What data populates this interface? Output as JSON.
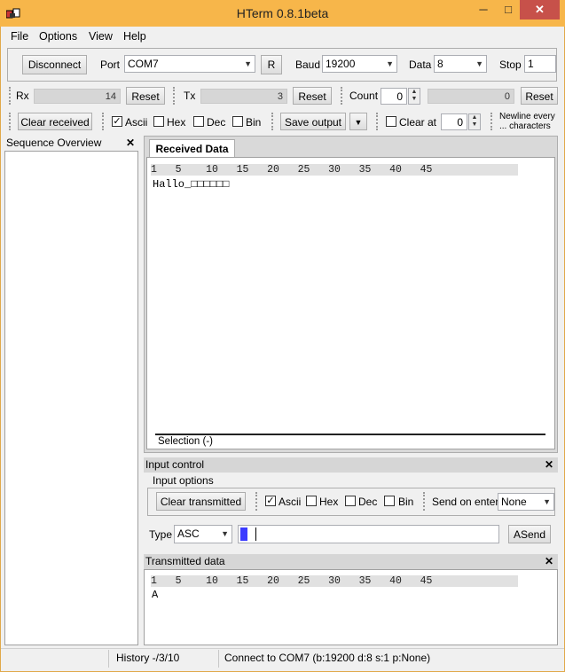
{
  "window": {
    "title": "HTerm 0.8.1beta",
    "min": "─",
    "max": "□",
    "close": "✕"
  },
  "menu": [
    "File",
    "Options",
    "View",
    "Help"
  ],
  "connection": {
    "disconnect": "Disconnect",
    "port_label": "Port",
    "port_value": "COM7",
    "r_button": "R",
    "baud_label": "Baud",
    "baud_value": "19200",
    "data_label": "Data",
    "data_value": "8",
    "stop_label": "Stop",
    "stop_value": "1"
  },
  "counters": {
    "rx_label": "Rx",
    "rx_value": "14",
    "rx_reset": "Reset",
    "tx_label": "Tx",
    "tx_value": "3",
    "tx_reset": "Reset",
    "count_label": "Count",
    "count_value": "0",
    "count_display": "0",
    "count_reset": "Reset"
  },
  "display_opts": {
    "clear_received": "Clear received",
    "ascii": "Ascii",
    "hex": "Hex",
    "dec": "Dec",
    "bin": "Bin",
    "save_output": "Save output",
    "clear_at": "Clear at",
    "clear_at_value": "0",
    "newline_1": "Newline every",
    "newline_2": "... characters",
    "check_mark": "✓"
  },
  "sequence": {
    "title": "Sequence Overview",
    "close": "✕"
  },
  "received": {
    "tab": "Received Data",
    "ruler": "1   5    10   15   20   25   30   35   40   45",
    "content": "Hallo_□□□□□□",
    "selection": "Selection (-)"
  },
  "input_control": {
    "title": "Input control",
    "close": "✕",
    "options_title": "Input options",
    "clear_transmitted": "Clear transmitted",
    "ascii": "Ascii",
    "hex": "Hex",
    "dec": "Dec",
    "bin": "Bin",
    "send_on_enter_label": "Send on enter",
    "send_on_enter_value": "None",
    "type_label": "Type",
    "type_value": "ASC",
    "asend": "ASend",
    "check_mark": "✓"
  },
  "transmitted": {
    "title": "Transmitted data",
    "close": "✕",
    "ruler": "1   5    10   15   20   25   30   35   40   45",
    "content": "A"
  },
  "statusbar": {
    "history": "History -/3/10",
    "connection": "Connect to COM7 (b:19200 d:8 s:1 p:None)"
  },
  "colors": {
    "titlebar": "#f7b64a",
    "close": "#c7514a",
    "cursor": "#3b3bff"
  }
}
